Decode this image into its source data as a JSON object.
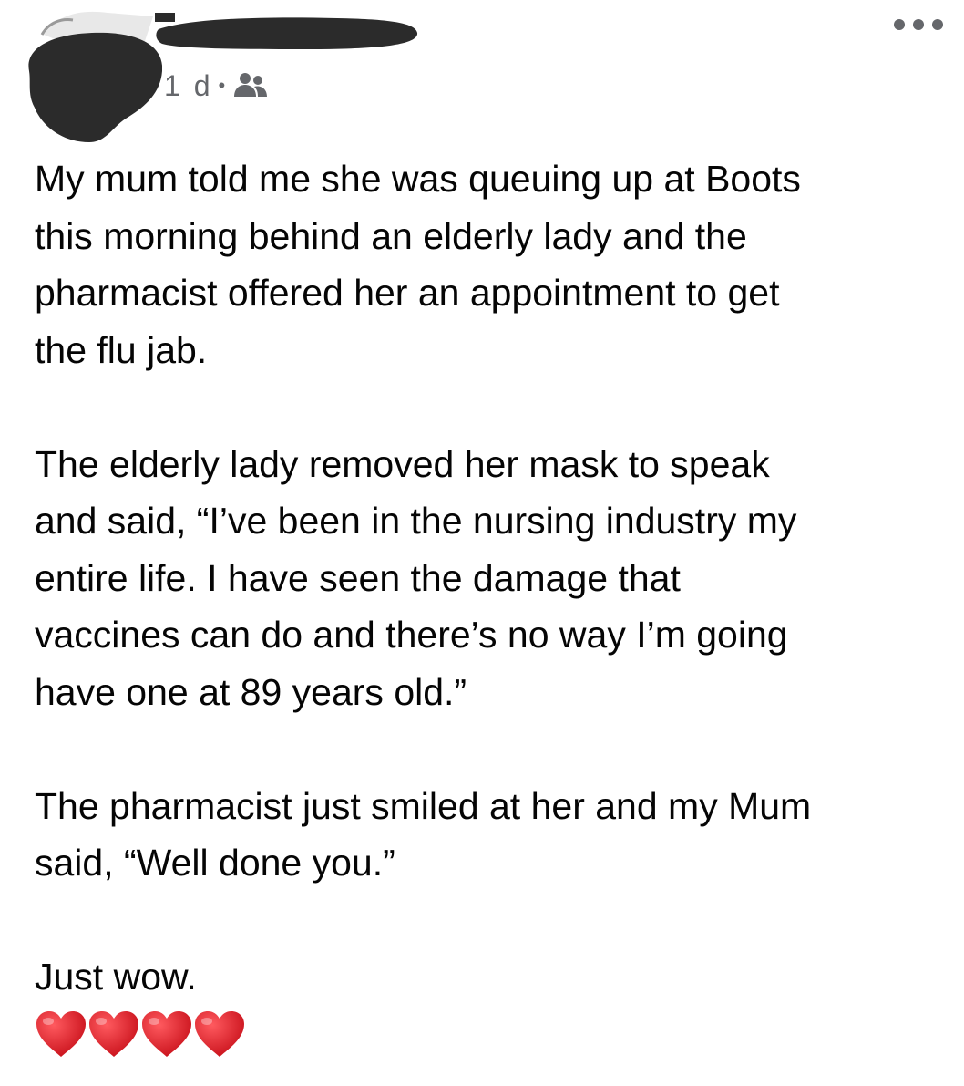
{
  "header": {
    "timestamp": "1 d",
    "separator": "•",
    "audience_icon": "friends-icon",
    "more_icon": "more-options-icon",
    "redaction_color": "#2b2b2b"
  },
  "post": {
    "paragraphs": [
      "My mum told me she was queuing up at Boots\nthis morning behind an elderly lady and the\npharmacist offered her an appointment to get\nthe flu jab.",
      "The elderly lady removed her mask to speak\nand said, “I’ve been in the nursing industry my\nentire life. I have seen the damage that\nvaccines can do and there’s no way I’m going\nhave one at 89 years old.”",
      "The pharmacist just smiled at her and my Mum\nsaid, “Well done you.”",
      "Just wow."
    ],
    "emoji": [
      "heart-icon",
      "heart-icon",
      "heart-icon",
      "heart-icon"
    ],
    "emoji_color": "#e0161e"
  }
}
